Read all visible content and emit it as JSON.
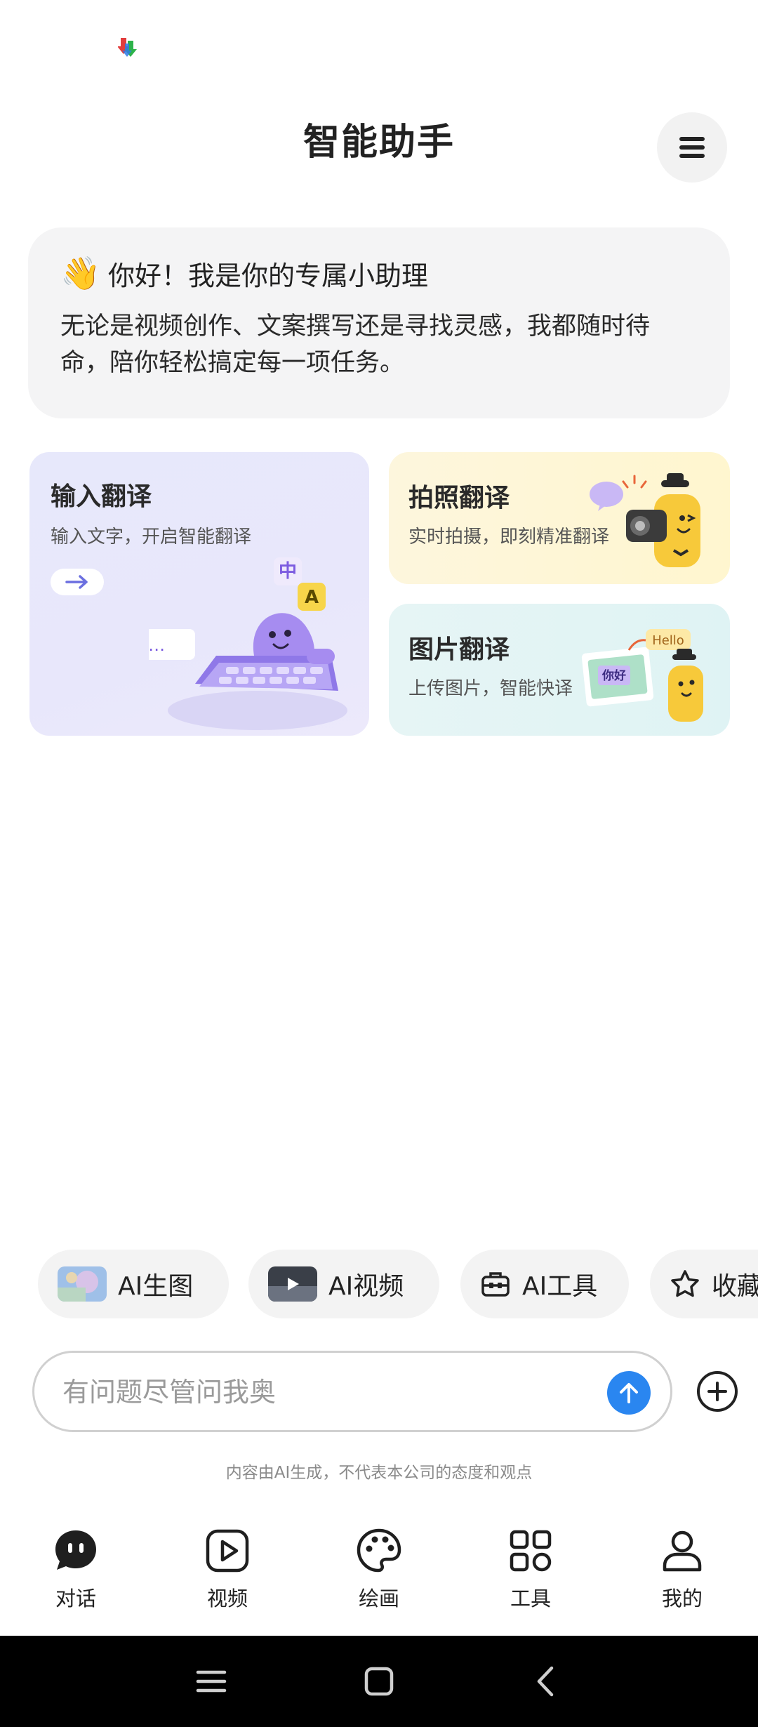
{
  "header": {
    "title": "智能助手"
  },
  "greeting": {
    "emoji": "👋",
    "title": "你好！我是你的专属小助理",
    "body": "无论是视频创作、文案撰写还是寻找灵感，我都随时待命，陪你轻松搞定每一项任务。"
  },
  "cards": {
    "input": {
      "title": "输入翻译",
      "subtitle": "输入文字，开启智能翻译",
      "illus_text": "I…",
      "badge_zh": "中",
      "badge_en": "A"
    },
    "photo": {
      "title": "拍照翻译",
      "subtitle": "实时拍摄，即刻精准翻译"
    },
    "image": {
      "title": "图片翻译",
      "subtitle": "上传图片，智能快译",
      "tag_hello": "Hello",
      "tag_nihao": "你好"
    }
  },
  "chips": [
    {
      "label": "AI生图",
      "icon": "ai-image-thumbnail"
    },
    {
      "label": "AI视频",
      "icon": "ai-video-thumbnail"
    },
    {
      "label": "AI工具",
      "icon": "toolbox-icon"
    },
    {
      "label": "收藏",
      "icon": "star-icon"
    }
  ],
  "composer": {
    "placeholder": "有问题尽管问我奥"
  },
  "disclaimer": "内容由AI生成，不代表本公司的态度和观点",
  "nav": [
    {
      "label": "对话",
      "icon": "chat-bubble-icon"
    },
    {
      "label": "视频",
      "icon": "play-square-icon"
    },
    {
      "label": "绘画",
      "icon": "palette-icon"
    },
    {
      "label": "工具",
      "icon": "grid-apps-icon"
    },
    {
      "label": "我的",
      "icon": "person-icon"
    }
  ],
  "colors": {
    "accent": "#2a86f0",
    "card_input": "#e7e8fb",
    "card_photo": "#fdf6dd",
    "card_image": "#e2f4f4"
  }
}
